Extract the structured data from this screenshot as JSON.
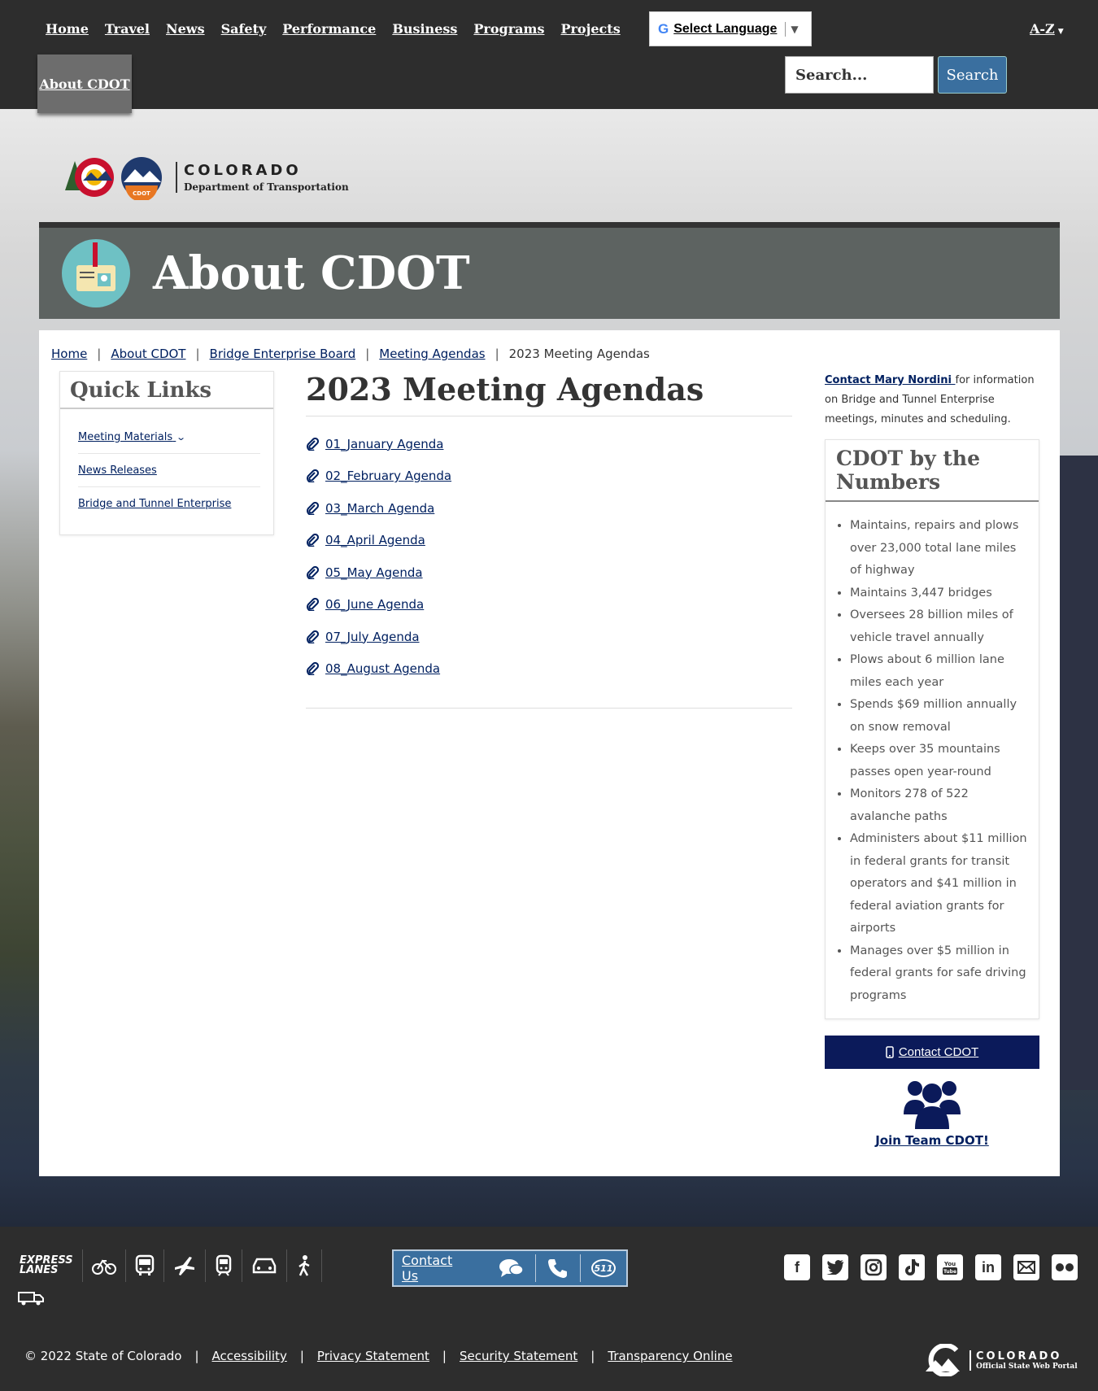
{
  "nav": {
    "items": [
      "Home",
      "Travel",
      "News",
      "Safety",
      "Performance",
      "Business",
      "Programs",
      "Projects"
    ],
    "active_tab": "About CDOT",
    "az_label": "A-Z"
  },
  "language": {
    "label": "Select Language"
  },
  "search": {
    "placeholder": "Search...",
    "button_label": "Search"
  },
  "logo": {
    "main": "COLORADO",
    "sub": "Department of Transportation",
    "badge": "CDOT"
  },
  "banner": {
    "title": "About CDOT"
  },
  "breadcrumb": {
    "links": [
      "Home",
      "About CDOT",
      "Bridge Enterprise Board",
      "Meeting Agendas"
    ],
    "current": "2023 Meeting Agendas"
  },
  "quick_links": {
    "title": "Quick Links",
    "items": [
      "Meeting Materials",
      "News Releases",
      "Bridge and Tunnel Enterprise"
    ]
  },
  "main": {
    "title": "2023 Meeting Agendas",
    "agendas": [
      "01_January Agenda",
      "02_February Agenda",
      "03_March Agenda",
      "04_April Agenda",
      "05_May Agenda",
      "06_June Agenda",
      "07_July Agenda",
      "08_August Agenda"
    ]
  },
  "sidebar": {
    "contact_link": "Contact Mary Nordini ",
    "contact_text": "for information on Bridge and Tunnel Enterprise meetings, minutes and scheduling.",
    "numbers_title": "CDOT by the Numbers",
    "numbers": [
      "Maintains, repairs and plows over 23,000 total lane miles of highway",
      "Maintains 3,447 bridges",
      "Oversees 28 billion miles of vehicle travel annually",
      "Plows about 6 million lane miles each year",
      "Spends $69 million annually on snow removal",
      "Keeps over 35 mountains passes open year-round",
      "Monitors 278 of 522 avalanche paths",
      "Administers about $11 million in federal grants for transit operators and $41 million in federal aviation grants for airports",
      "Manages over $5 million in federal grants for safe driving programs"
    ],
    "contact_button": "Contact CDOT",
    "team_link": "Join Team CDOT!"
  },
  "footer": {
    "express": [
      "EXPRESS",
      "LANES"
    ],
    "contact_us": "Contact Us",
    "contact_511": "511",
    "copyright": "© 2022 State of Colorado",
    "legal_links": [
      "Accessibility",
      "Privacy Statement",
      "Security Statement",
      "Transparency Online"
    ],
    "state_logo_main": "COLORADO",
    "state_logo_sub": "Official State Web Portal"
  },
  "colors": {
    "nav_bg": "#2d2d2d",
    "banner_bg": "#5d6361",
    "link": "#002060",
    "button_blue": "#3a6f9f",
    "contact_btn": "#0b1a5a"
  }
}
